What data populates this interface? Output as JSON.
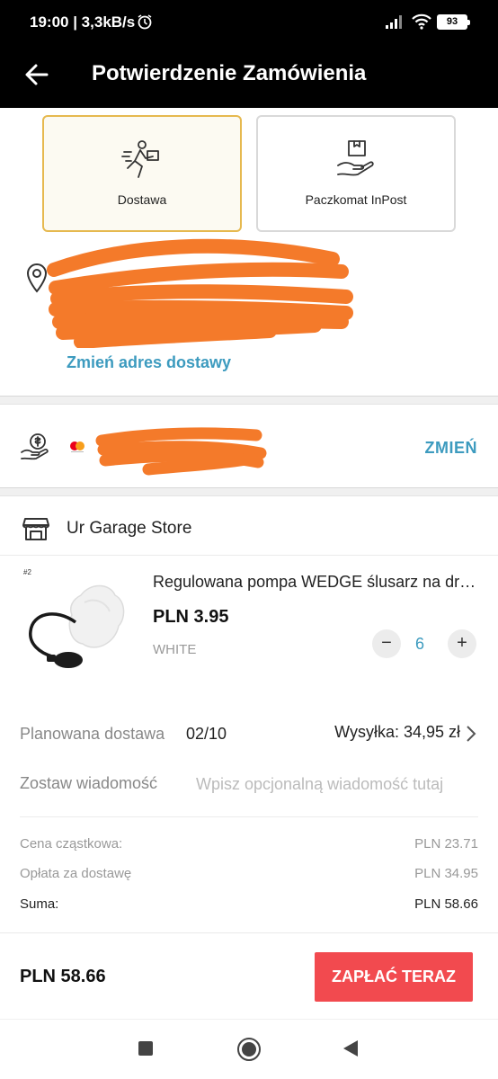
{
  "status_bar": {
    "time": "19:00 | 3,3kB/s",
    "battery": "93"
  },
  "header": {
    "title": "Potwierdzenie Zamówienia"
  },
  "delivery_options": [
    {
      "label": "Dostawa",
      "selected": true
    },
    {
      "label": "Paczkomat InPost",
      "selected": false
    }
  ],
  "address": {
    "change_label": "Zmień adres dostawy"
  },
  "payment": {
    "change_label": "ZMIEŃ"
  },
  "store": {
    "name": "Ur Garage Store"
  },
  "product": {
    "tag": "#2",
    "title": "Regulowana pompa WEDGE ślusarz na drzwi samochodu",
    "price": "PLN 3.95",
    "variant": "WHITE",
    "quantity": "6",
    "minus": "−",
    "plus": "+"
  },
  "shipping": {
    "planned_label": "Planowana dostawa",
    "planned_date": "02/10",
    "cost": "Wysyłka: 34,95 zł"
  },
  "message": {
    "label": "Zostaw wiadomość",
    "placeholder": "Wpisz opcjonalną wiadomość tutaj"
  },
  "summary": {
    "subtotal_label": "Cena cząstkowa:",
    "subtotal_value": "PLN 23.71",
    "delivery_label": "Opłata za dostawę",
    "delivery_value": "PLN 34.95",
    "total_label": "Suma:",
    "total_value": "PLN 58.66"
  },
  "footer": {
    "total": "PLN 58.66",
    "pay_label": "ZAPŁAĆ TERAZ"
  },
  "colors": {
    "accent": "#3d9bbf",
    "pay": "#f24a4f",
    "selected_border": "#e6b94f",
    "redaction": "#f47a2a"
  }
}
